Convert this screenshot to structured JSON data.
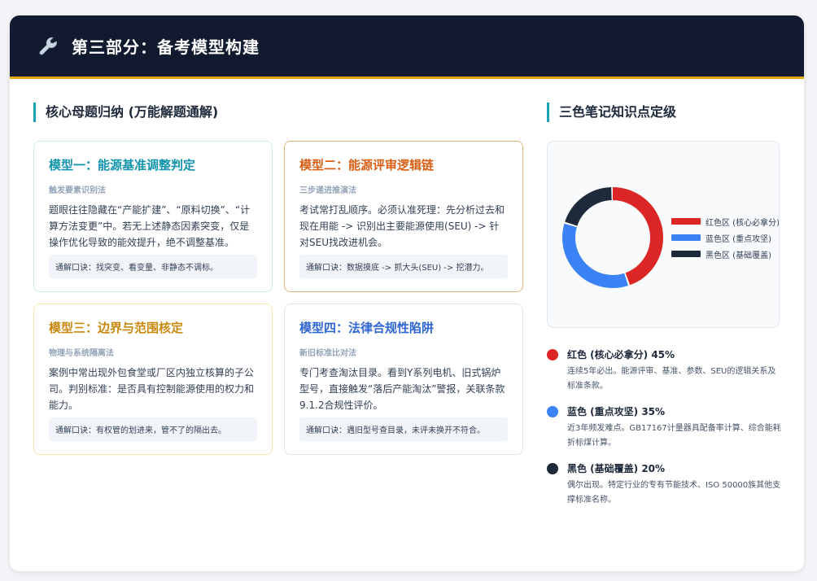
{
  "header": {
    "icon": "wrench-icon",
    "title": "第三部分：备考模型构建"
  },
  "left_section": {
    "title": "核心母题归纳 (万能解题通解)"
  },
  "models": [
    {
      "title": "模型一：能源基准调整判定",
      "subtitle": "触发要素识别法",
      "body": "题眼往往隐藏在“产能扩建”、“原料切换”、“计算方法变更”中。若无上述静态因素突变，仅是操作优化导致的能效提升，绝不调整基准。",
      "key": "通解口诀：找突变、看变量、非静态不调标。",
      "color": "#1294ab"
    },
    {
      "title": "模型二：能源评审逻辑链",
      "subtitle": "三步递进推演法",
      "body": "考试常打乱顺序。必须认准死理：先分析过去和现在用能 -> 识别出主要能源使用(SEU) -> 针对SEU找改进机会。",
      "key": "通解口诀：数据摸底 -> 抓大头(SEU) -> 挖潜力。",
      "color": "#d85f15"
    },
    {
      "title": "模型三：边界与范围核定",
      "subtitle": "物理与系统隔离法",
      "body": "案例中常出现外包食堂或厂区内独立核算的子公司。判别标准：是否具有控制能源使用的权力和能力。",
      "key": "通解口诀：有权管的划进来，管不了的隔出去。",
      "color": "#c9890f"
    },
    {
      "title": "模型四：法律合规性陷阱",
      "subtitle": "新旧标准比对法",
      "body": "专门考查淘汰目录。看到Y系列电机、旧式锅炉型号，直接触发“落后产能淘汰”警报，关联条款9.1.2合规性评价。",
      "key": "通解口诀：遇旧型号查目录，未评未换开不符合。",
      "color": "#2f66d4"
    }
  ],
  "right_section": {
    "title": "三色笔记知识点定级"
  },
  "chart_data": {
    "type": "pie",
    "donut": true,
    "categories": [
      "红色区 (核心必拿分)",
      "蓝色区 (重点攻坚)",
      "黑色区 (基础覆盖)"
    ],
    "values": [
      45,
      35,
      20
    ],
    "colors": [
      "#dc2626",
      "#3b82f6",
      "#1e293b"
    ],
    "legend": "right"
  },
  "notes": [
    {
      "title": "红色 (核心必拿分) 45%",
      "desc": "连续5年必出。能源评审、基准、参数、SEU的逻辑关系及标准条款。",
      "color": "#dc2626"
    },
    {
      "title": "蓝色 (重点攻坚) 35%",
      "desc": "近3年频发难点。GB17167计量器具配备率计算、综合能耗折标煤计算。",
      "color": "#3b82f6"
    },
    {
      "title": "黑色 (基础覆盖) 20%",
      "desc": "偶尔出现。特定行业的专有节能技术、ISO 50000族其他支撑标准名称。",
      "color": "#1e293b"
    }
  ]
}
